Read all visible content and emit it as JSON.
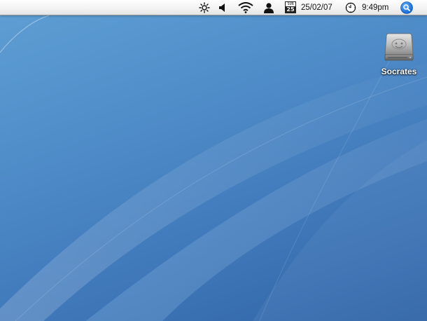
{
  "menubar": {
    "icons": {
      "brightness": "brightness-icon",
      "volume": "volume-icon",
      "wifi": "wifi-icon",
      "user": "user-icon",
      "calendar": "calendar-icon",
      "clock": "clock-icon",
      "spotlight": "spotlight-search-icon"
    },
    "calendar_day": "SUN",
    "calendar_date": "25",
    "date": "25/02/07",
    "time": "9:49pm"
  },
  "desktop": {
    "icons": [
      {
        "label": "Socrates",
        "icon": "hard-drive-icon"
      }
    ]
  },
  "colors": {
    "wallpaper": "#4f8dc9",
    "spotlight": "#1a6fd6",
    "menubar": "#f3f3f3"
  }
}
